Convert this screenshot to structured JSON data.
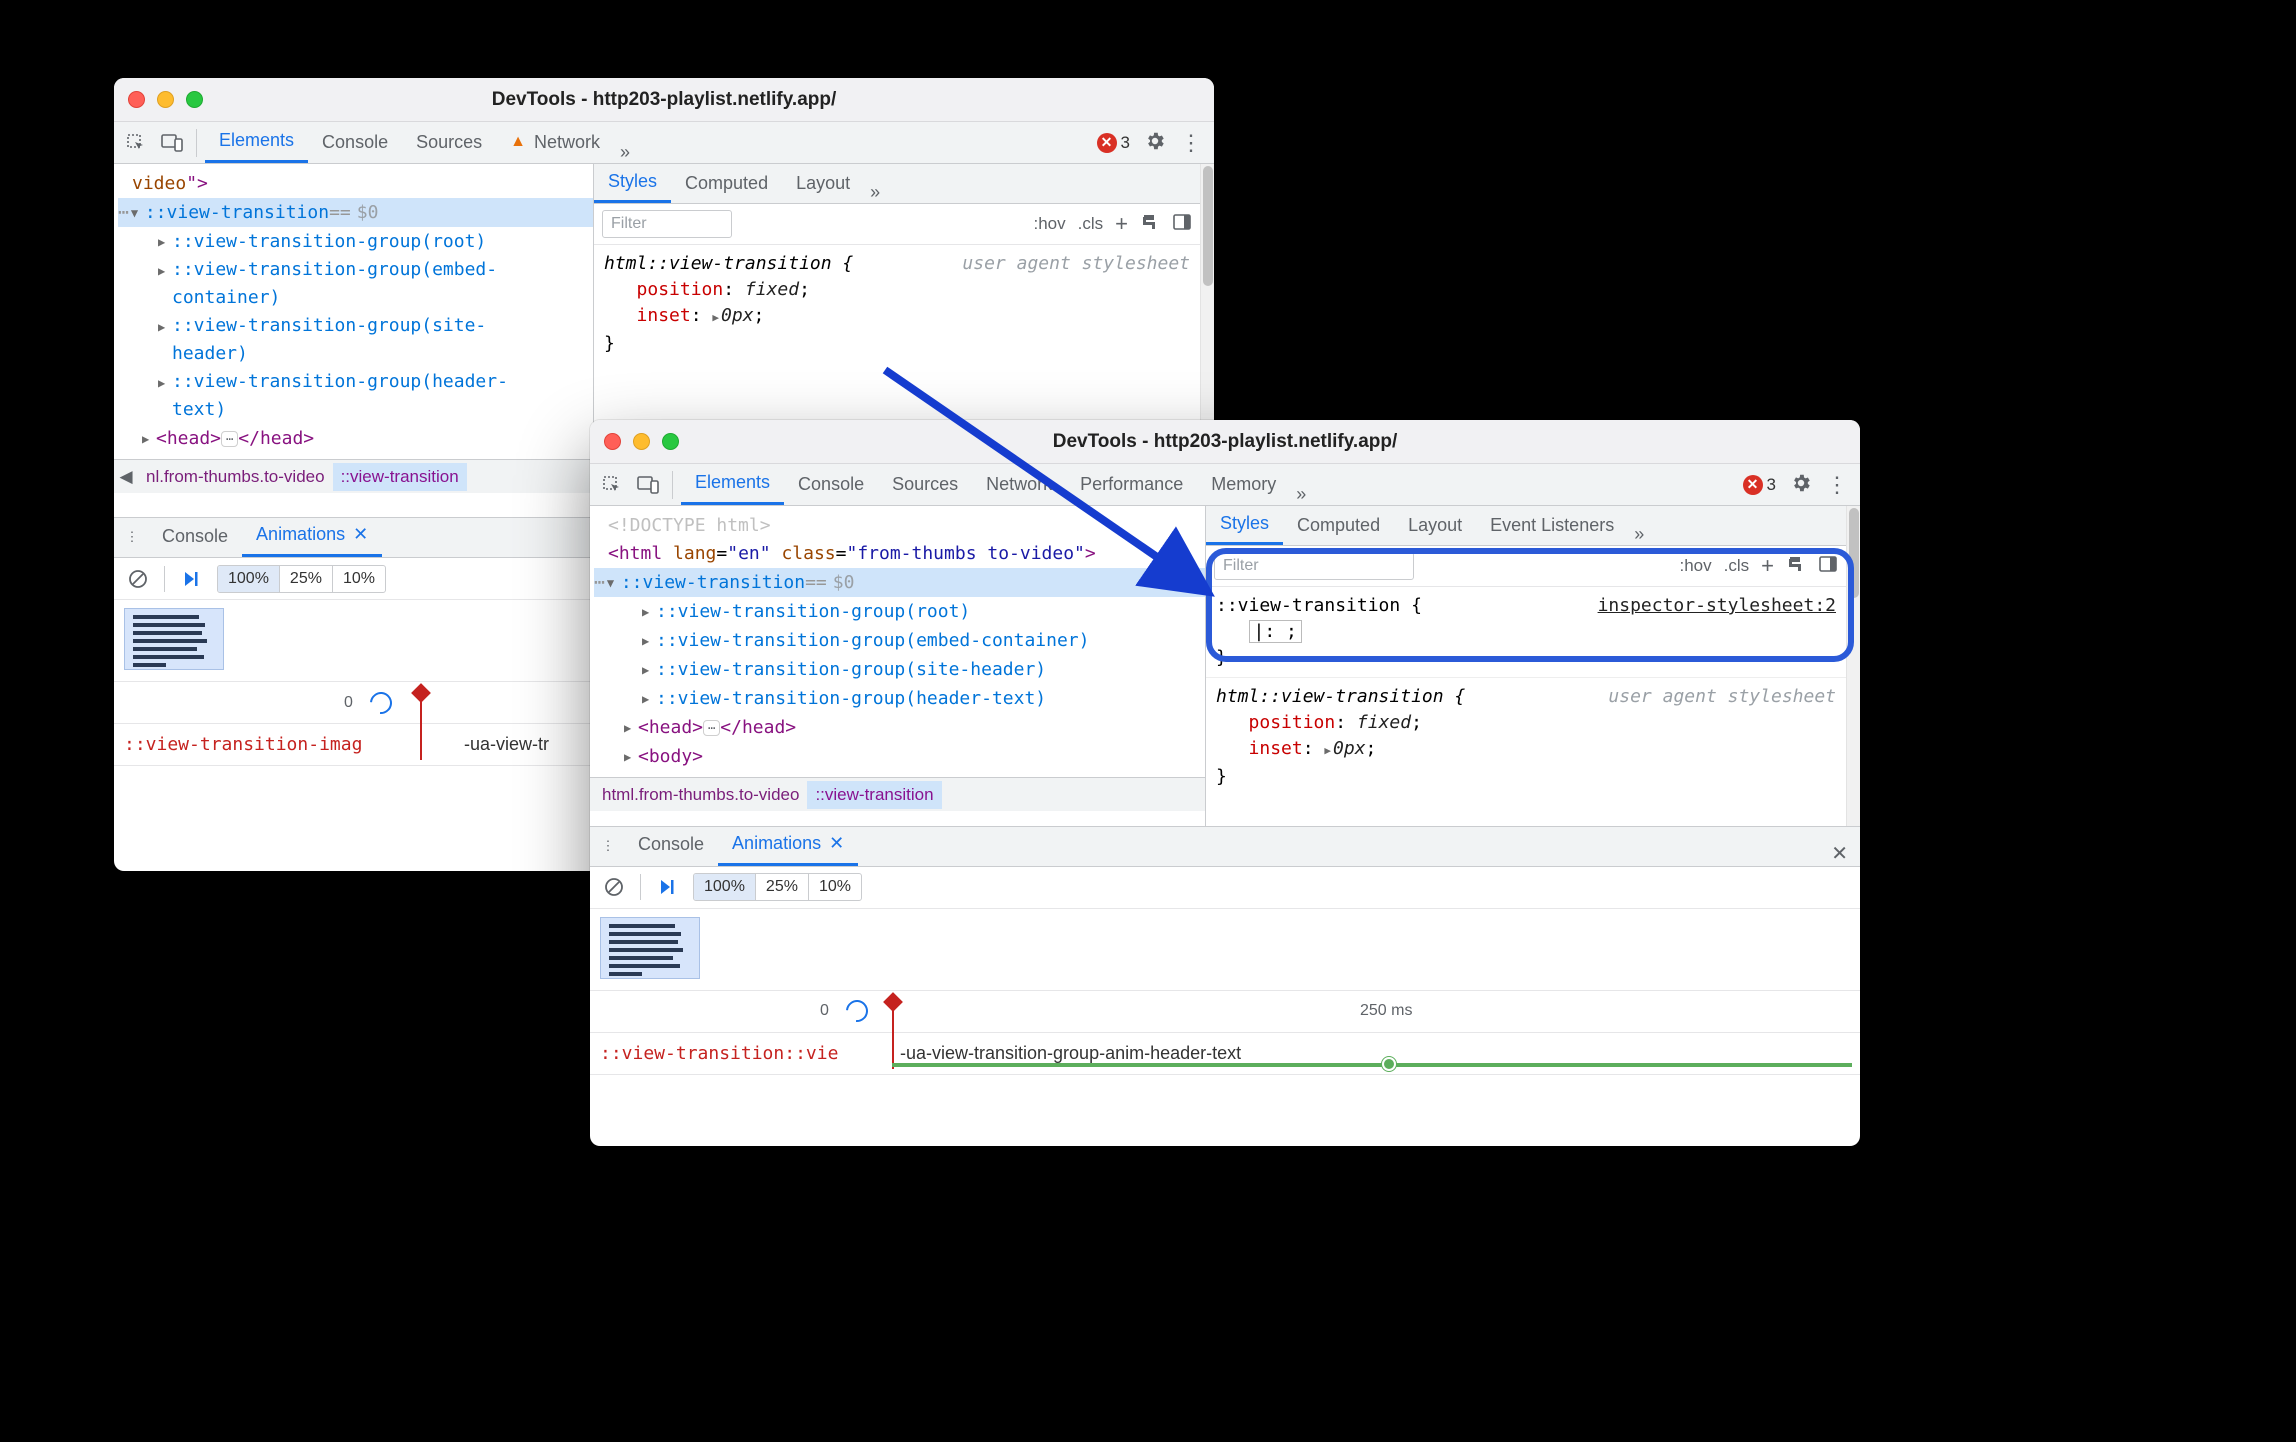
{
  "win1": {
    "title": "DevTools - http203-playlist.netlify.app/",
    "tabs": [
      "Elements",
      "Console",
      "Sources",
      "Network"
    ],
    "activeTab": 0,
    "errCount": "3",
    "tree": {
      "videoTag": "video",
      "selected": "::view-transition",
      "eq": "== ",
      "dollar": "$0",
      "groups": [
        "::view-transition-group(root)",
        "::view-transition-group(embed-container)",
        "::view-transition-group(site-header)",
        "::view-transition-group(header-text)"
      ],
      "head_open": "<head>",
      "head_close": "</head>"
    },
    "breadcrumb": {
      "left": "nl.from-thumbs.to-video",
      "right": "::view-transition"
    },
    "styles": {
      "subtabs": [
        "Styles",
        "Computed",
        "Layout"
      ],
      "filter": "Filter",
      "btns": {
        "hov": ":hov",
        "cls": ".cls"
      },
      "rule": {
        "selector": "html::view-transition {",
        "src": "user agent stylesheet",
        "p1n": "position",
        "p1v": "fixed",
        "p2n": "inset",
        "p2v": "0px",
        "close": "}"
      }
    },
    "drawer": {
      "tabs": [
        "Console",
        "Animations"
      ],
      "speeds": [
        "100%",
        "25%",
        "10%"
      ],
      "zero": "0",
      "animName": "::view-transition-imag",
      "animLabel": "-ua-view-tr"
    }
  },
  "win2": {
    "title": "DevTools - http203-playlist.netlify.app/",
    "tabs": [
      "Elements",
      "Console",
      "Sources",
      "Network",
      "Performance",
      "Memory"
    ],
    "activeTab": 0,
    "errCount": "3",
    "tree": {
      "doctype": "<!DOCTYPE html>",
      "html_open_a": "<",
      "html_tag": "html",
      "html_lang_n": "lang",
      "html_lang_v": "\"en\"",
      "html_class_n": "class",
      "html_class_v": "\"from-thumbs to-video\"",
      "html_open_b": ">",
      "selected": "::view-transition",
      "eq": "== ",
      "dollar": "$0",
      "groups": [
        "::view-transition-group(root)",
        "::view-transition-group(embed-container)",
        "::view-transition-group(site-header)",
        "::view-transition-group(header-text)"
      ],
      "head_open": "<head>",
      "head_close": "</head>",
      "body_open": "<body>"
    },
    "breadcrumb": {
      "left": "html.from-thumbs.to-video",
      "right": "::view-transition"
    },
    "styles": {
      "subtabs": [
        "Styles",
        "Computed",
        "Layout",
        "Event Listeners"
      ],
      "filter": "Filter",
      "btns": {
        "hov": ":hov",
        "cls": ".cls"
      },
      "rule_focus": {
        "selector": "::view-transition {",
        "src": "inspector-stylesheet:2",
        "editing": "|:  ;",
        "close": "}"
      },
      "rule_ua": {
        "selector": "html::view-transition {",
        "src": "user agent stylesheet",
        "p1n": "position",
        "p1v": "fixed",
        "p2n": "inset",
        "p2v": "0px",
        "close": "}"
      }
    },
    "drawer": {
      "tabs": [
        "Console",
        "Animations"
      ],
      "speeds": [
        "100%",
        "25%",
        "10%"
      ],
      "zero": "0",
      "ms": "250 ms",
      "animName": "::view-transition::vie",
      "animLabel": "-ua-view-transition-group-anim-header-text"
    }
  }
}
